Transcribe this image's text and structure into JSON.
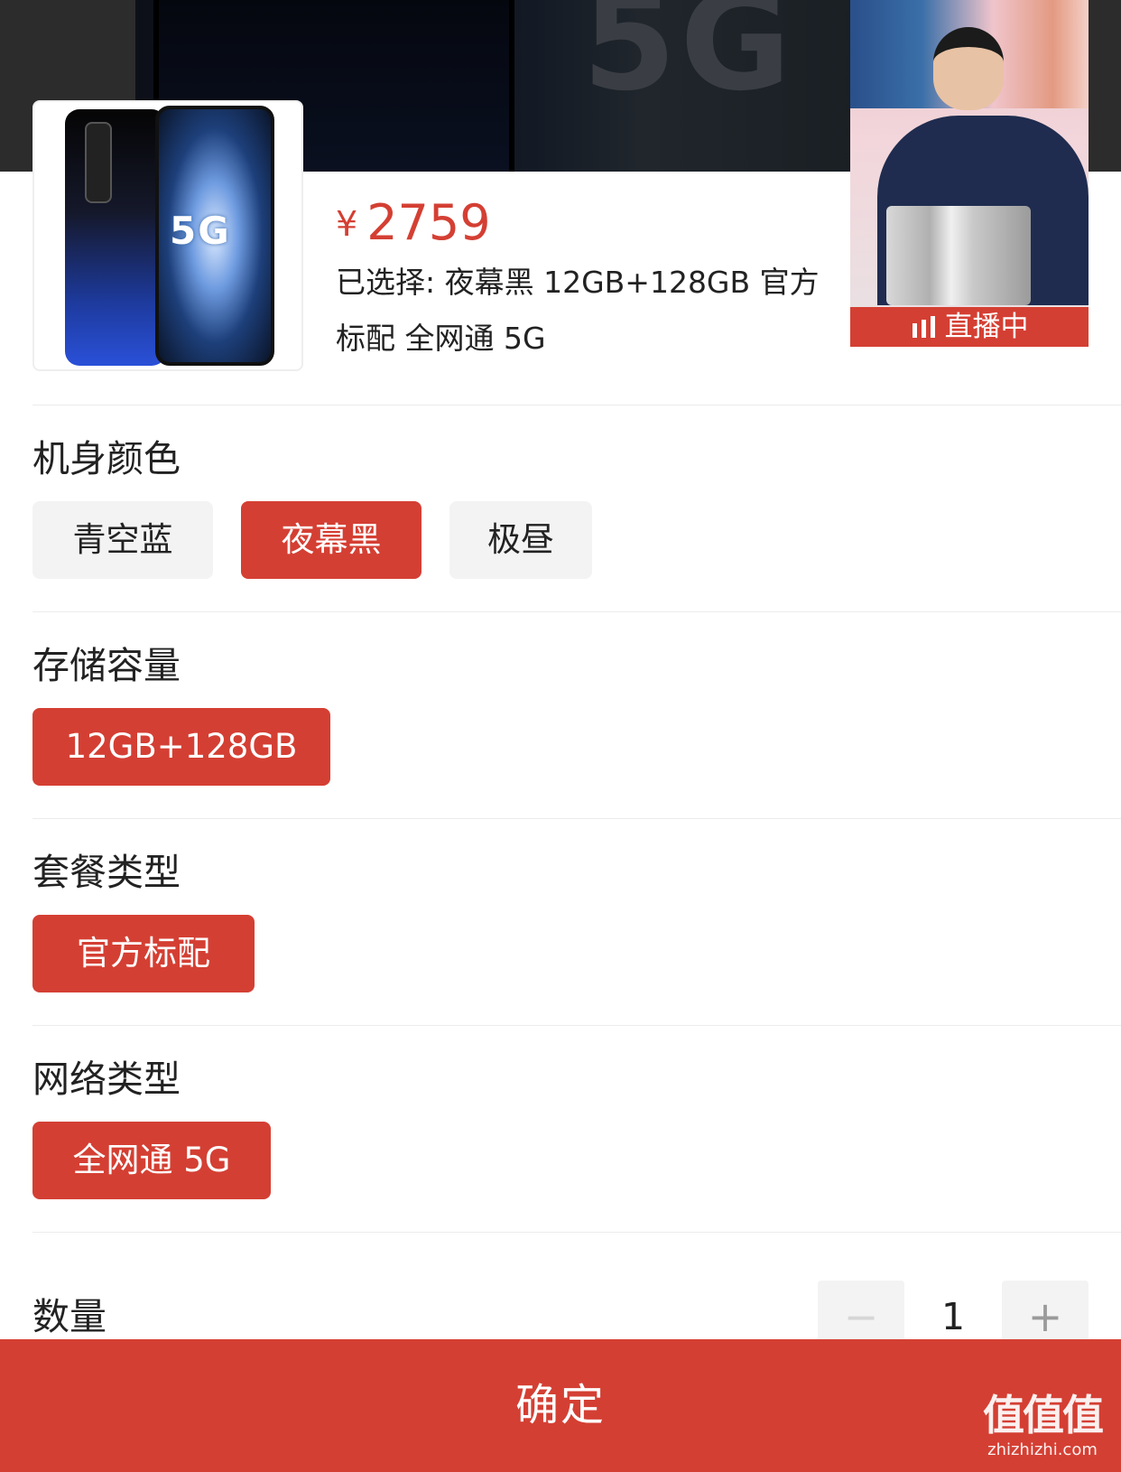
{
  "product": {
    "price_symbol": "¥",
    "price": "2759",
    "selected_text": "已选择: 夜幕黑 12GB+128GB 官方标配 全网通 5G",
    "thumbnail_text": "5G"
  },
  "banner": {
    "text": "5G"
  },
  "live": {
    "badge_label": "直播中"
  },
  "sections": [
    {
      "title": "机身颜色",
      "options": [
        {
          "label": "青空蓝",
          "selected": false
        },
        {
          "label": "夜幕黑",
          "selected": true
        },
        {
          "label": "极昼",
          "selected": false
        }
      ]
    },
    {
      "title": "存储容量",
      "options": [
        {
          "label": "12GB+128GB",
          "selected": true
        }
      ]
    },
    {
      "title": "套餐类型",
      "options": [
        {
          "label": "官方标配",
          "selected": true
        }
      ]
    },
    {
      "title": "网络类型",
      "options": [
        {
          "label": "全网通 5G",
          "selected": true
        }
      ]
    }
  ],
  "quantity": {
    "label": "数量",
    "value": "1",
    "minus_label": "−",
    "plus_label": "+"
  },
  "confirm_label": "确定",
  "watermark": {
    "logo": "值值值",
    "url": "zhizhizhi.com"
  },
  "colors": {
    "accent": "#d43f33",
    "chip_off": "#f3f3f3",
    "text": "#222222"
  }
}
